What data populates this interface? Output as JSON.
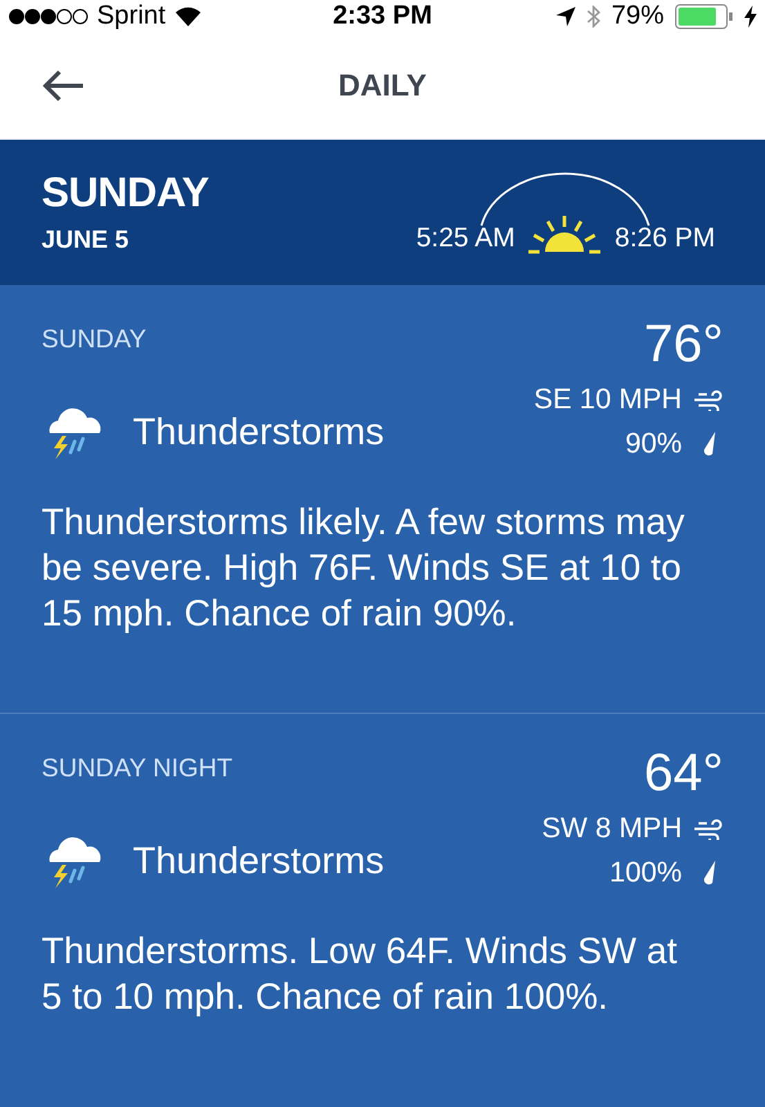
{
  "status_bar": {
    "carrier": "Sprint",
    "time": "2:33 PM",
    "battery": "79%"
  },
  "nav": {
    "title": "DAILY"
  },
  "day_header": {
    "day": "SUNDAY",
    "date": "JUNE 5",
    "sunrise": "5:25 AM",
    "sunset": "8:26 PM"
  },
  "periods": [
    {
      "name": "SUNDAY",
      "temperature": "76°",
      "wind": "SE 10 MPH",
      "precipitation": "90%",
      "condition": "Thunderstorms",
      "description": "Thunderstorms likely. A few storms may be severe. High 76F. Winds SE at 10 to 15 mph. Chance of rain 90%."
    },
    {
      "name": "SUNDAY NIGHT",
      "temperature": "64°",
      "wind": "SW 8 MPH",
      "precipitation": "100%",
      "condition": "Thunderstorms",
      "description": "Thunderstorms. Low 64F. Winds SW at 5 to 10 mph. Chance of rain 100%."
    }
  ]
}
